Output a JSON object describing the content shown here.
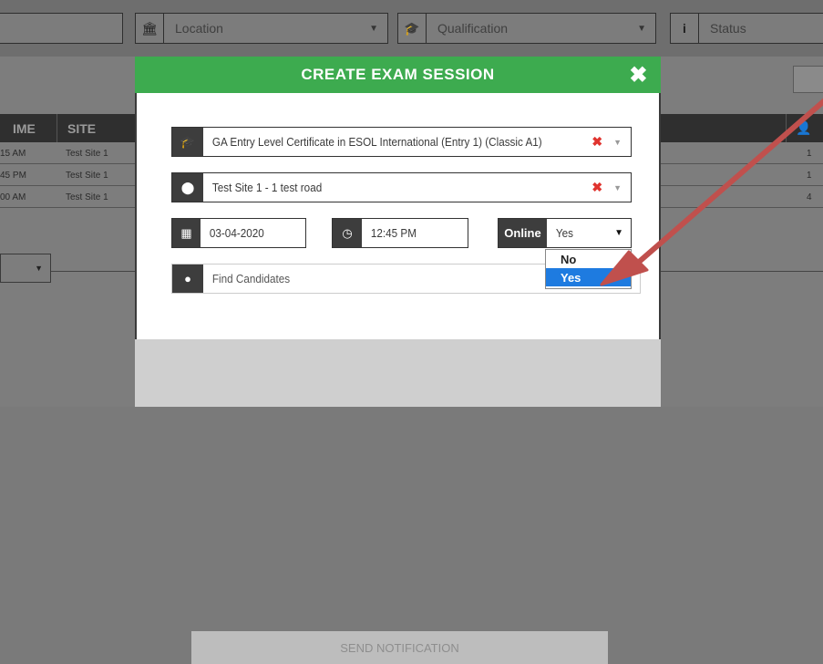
{
  "filters": {
    "location_placeholder": "Location",
    "qualification_placeholder": "Qualification",
    "status_placeholder": "Status"
  },
  "table": {
    "headers": [
      "IME",
      "SITE"
    ],
    "rows": [
      {
        "time": "15 AM",
        "site": "Test Site 1",
        "count": "1"
      },
      {
        "time": "45 PM",
        "site": "Test Site 1",
        "count": "1"
      },
      {
        "time": "00 AM",
        "site": "Test Site 1",
        "count": "4"
      }
    ]
  },
  "modal": {
    "title": "CREATE EXAM SESSION",
    "close_symbol": "✖",
    "qualification_value": "GA Entry Level Certificate in ESOL International (Entry 1) (Classic A1)",
    "site_value": "Test Site 1 - 1 test road",
    "date_value": "03-04-2020",
    "time_value": "12:45 PM",
    "online_label": "Online",
    "online_value": "Yes",
    "online_options": [
      "No",
      "Yes"
    ],
    "candidates_placeholder": "Find Candidates",
    "send_label": "SEND NOTIFICATION"
  },
  "colors": {
    "header_green": "#3dab4f",
    "clear_red": "#e0342f",
    "selected_blue": "#1e7be0",
    "arrow": "#c0504d"
  }
}
